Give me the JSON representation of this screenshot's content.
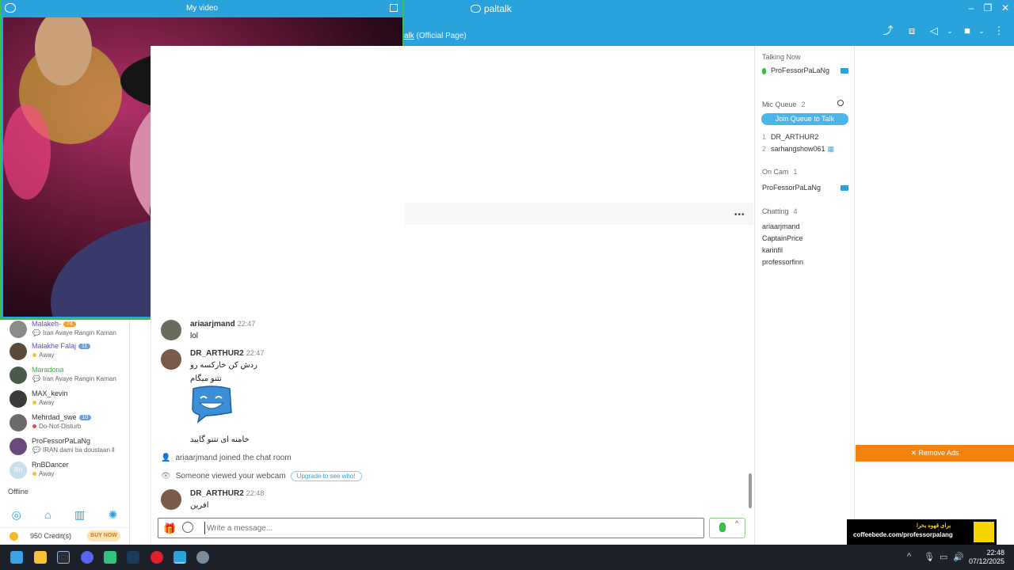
{
  "app": {
    "brand": "paltalk",
    "room_link": "alk",
    "room_suffix": " (Official Page)"
  },
  "video": {
    "title": "My video"
  },
  "sidebar": {
    "users": [
      {
        "name": "Malakeh-",
        "badge": "74",
        "status": "Iran Avaye Rangin Kaman",
        "status_type": "chat"
      },
      {
        "name": "Malakhe Falaj",
        "badge": "11",
        "status": "Away",
        "status_type": "away"
      },
      {
        "name": "Maradona",
        "badge": "",
        "status": "Iran Avaye Rangin Kaman",
        "status_type": "chat"
      },
      {
        "name": "MAX_kevin",
        "badge": "",
        "status": "Away",
        "status_type": "away"
      },
      {
        "name": "Mehrdad_swe",
        "badge": "10",
        "status": "Do-Not-Disturb",
        "status_type": "dnd"
      },
      {
        "name": "ProFessorPaLaNg",
        "badge": "",
        "status": "IRAN dami ba doustaan ll",
        "status_type": "chat"
      },
      {
        "name": "RnBDancer",
        "badge": "",
        "status": "Away",
        "status_type": "away",
        "initials": "Rn"
      }
    ],
    "offline_label": "Offline",
    "credits": "950 Credit(s)",
    "buy_now": "BUY NOW"
  },
  "chat": {
    "messages": [
      {
        "user": "ariaarjmand",
        "time": "22:47",
        "lines": [
          "lol"
        ]
      },
      {
        "user": "DR_ARTHUR2",
        "time": "22:47",
        "lines": [
          "ردش کن خارکسه رو",
          "نتنو میگام",
          "خامنه ای نتنو گایید"
        ]
      },
      {
        "user": "DR_ARTHUR2",
        "time": "22:48",
        "lines": [
          "افرین"
        ]
      }
    ],
    "system_join": "ariaarjmand joined the chat room",
    "system_viewed": "Someone viewed your webcam",
    "upgrade_label": "Upgrade to see who!",
    "input_placeholder": "Write a message..."
  },
  "right_panel": {
    "talking_now_label": "Talking Now",
    "talking_now_user": "ProFessorPaLaNg",
    "mic_queue_label": "Mic Queue",
    "mic_queue_count": "2",
    "join_queue": "Join Queue to Talk",
    "queue": [
      {
        "num": "1",
        "name": "DR_ARTHUR2"
      },
      {
        "num": "2",
        "name": "sarhangshow061"
      }
    ],
    "on_cam_label": "On Cam",
    "on_cam_count": "1",
    "on_cam_user": "ProFessorPaLaNg",
    "chatting_label": "Chatting",
    "chatting_count": "4",
    "chatting": [
      "ariaarjmand",
      "CaptainPrice",
      "karinfil",
      "professorfinn"
    ]
  },
  "ads": {
    "remove_ads": "✕ Remove Ads",
    "banner_line1": "برای قهوه بخرا",
    "banner_line2": "coffeebede.com/professorpalang"
  },
  "taskbar": {
    "time": "22:48",
    "date": "07/12/2025"
  },
  "colors": {
    "accent": "#2aa3dd",
    "video_border": "#39c050",
    "ads_orange": "#f5840e",
    "taskbar": "#1d2129"
  }
}
